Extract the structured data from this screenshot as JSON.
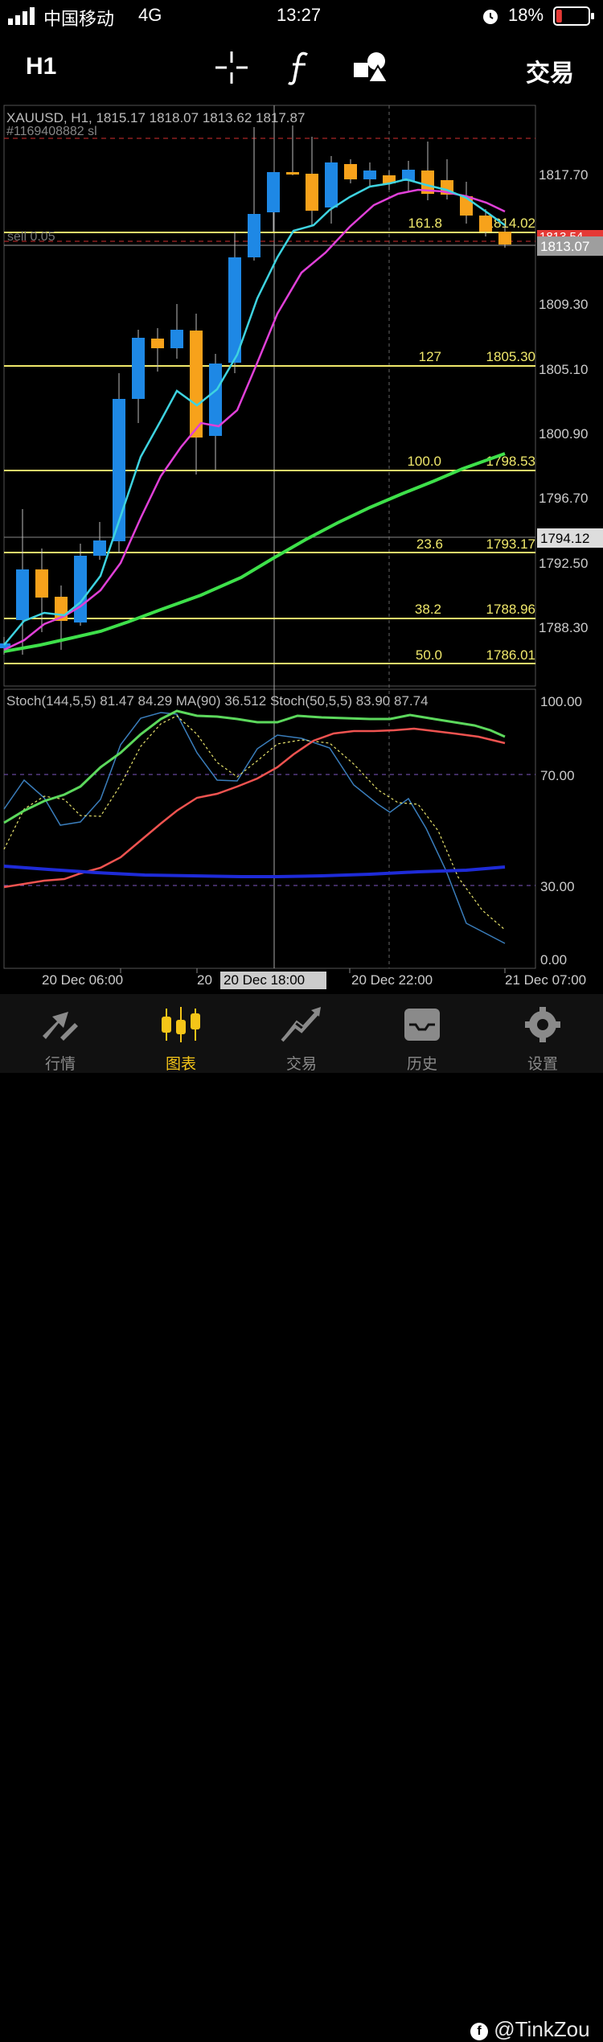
{
  "status_bar": {
    "carrier": "中国移动",
    "network": "4G",
    "time": "13:27",
    "battery": "18%",
    "battery_level": 0.18
  },
  "toolbar": {
    "timeframe": "H1",
    "trade_label": "交易",
    "icons": [
      "crosshair-icon",
      "function-icon",
      "objects-icon"
    ]
  },
  "chart": {
    "header_line": "XAUUSD, H1, 1815.17 1818.07 1813.62 1817.87",
    "order_id": "#1169408882 sl",
    "position_label": "sell 0.05",
    "price_labels": [
      "1817.70",
      "1809.30",
      "1805.10",
      "1800.90",
      "1796.70",
      "1792.50",
      "1788.30"
    ],
    "current_price": "1813.07",
    "red_price_partial": "1813.54",
    "crosshair_price": "1794.12",
    "fib_levels": [
      {
        "ratio": "161.8",
        "price": "1814.02"
      },
      {
        "ratio": "127",
        "price": "1805.30"
      },
      {
        "ratio": "100.0",
        "price": "1798.53"
      },
      {
        "ratio": "23.6",
        "price": "1793.17"
      },
      {
        "ratio": "38.2",
        "price": "1788.96"
      },
      {
        "ratio": "50.0",
        "price": "1786.01"
      }
    ],
    "indicator_header": "Stoch(144,5,5) 81.47 84.29 MA(90) 36.512 Stoch(50,5,5) 83.90 87.74",
    "indicator_labels": [
      "100.00",
      "70.00",
      "30.00",
      "0.00"
    ],
    "time_labels": [
      "20 Dec 06:00",
      "20",
      "20 Dec 18:00",
      "20 Dec 22:00",
      "21 Dec 07:00"
    ],
    "colors": {
      "bull": "#1e88e5",
      "bear": "#f7a21b",
      "fib": "#f0e86b",
      "ma_fast": "#3ed3e0",
      "ma_mid": "#e040d8",
      "ma_slow": "#3ee04a",
      "grid": "#444444"
    }
  },
  "tabbar": {
    "tabs": [
      {
        "label": "行情",
        "icon": "quotes-icon"
      },
      {
        "label": "图表",
        "icon": "chart-icon",
        "active": true
      },
      {
        "label": "交易",
        "icon": "trade-icon"
      },
      {
        "label": "历史",
        "icon": "history-icon"
      },
      {
        "label": "设置",
        "icon": "settings-icon"
      }
    ]
  },
  "watermark": "@TinkZou"
}
